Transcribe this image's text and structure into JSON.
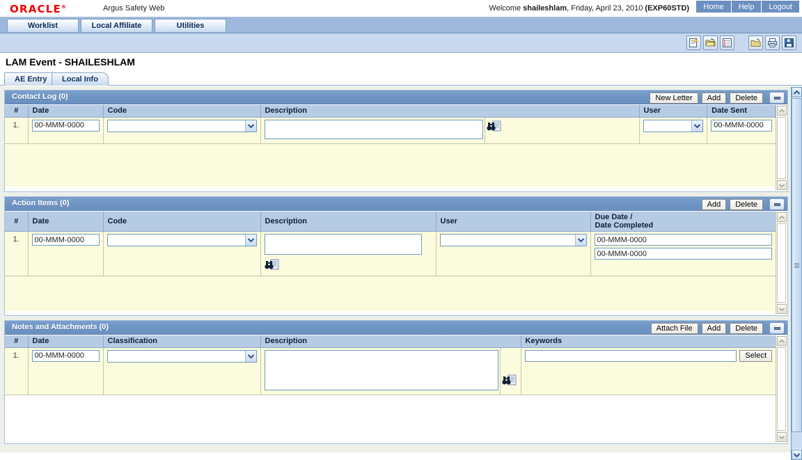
{
  "topbar": {
    "logo": "ORACLE",
    "logo_mark": "®",
    "app_title": "Argus Safety Web",
    "welcome_prefix": "Welcome ",
    "welcome_user": "shaileshlam",
    "welcome_suffix": ", Friday, April 23, 2010 ",
    "welcome_env": "(EXP60STD)",
    "nav": [
      {
        "label": "Home",
        "name": "home-link"
      },
      {
        "label": "Help",
        "name": "help-link"
      },
      {
        "label": "Logout",
        "name": "logout-link"
      }
    ]
  },
  "menubar": {
    "tabs": [
      {
        "label": "Worklist"
      },
      {
        "label": "Local Affiliate"
      },
      {
        "label": "Utilities"
      }
    ]
  },
  "toolbar": {
    "icons": [
      {
        "name": "new-case-icon",
        "title": "New"
      },
      {
        "name": "open-case-icon",
        "title": "Open"
      },
      {
        "name": "list-view-icon",
        "title": "List"
      },
      {
        "name": "revert-folder-icon",
        "title": "Revert"
      },
      {
        "name": "print-icon",
        "title": "Print"
      },
      {
        "name": "save-icon",
        "title": "Save"
      }
    ]
  },
  "page": {
    "title": "LAM Event - SHAILESHLAM",
    "tabs": [
      {
        "label": "AE Entry",
        "active": false
      },
      {
        "label": "Local Info",
        "active": true
      }
    ]
  },
  "contact_log": {
    "title": "Contact Log (0)",
    "buttons": [
      {
        "label": "New Letter",
        "name": "new-letter-button"
      },
      {
        "label": "Add",
        "name": "add-button"
      },
      {
        "label": "Delete",
        "name": "delete-button"
      }
    ],
    "minimize_title": "Minimize",
    "columns": [
      "#",
      "Date",
      "Code",
      "Description",
      "User",
      "Date Sent"
    ],
    "rows": [
      {
        "num": "1.",
        "date": "00-MMM-0000",
        "code": "",
        "description": "",
        "user": "",
        "date_sent": "00-MMM-0000"
      }
    ]
  },
  "action_items": {
    "title": "Action Items (0)",
    "buttons": [
      {
        "label": "Add",
        "name": "add-button"
      },
      {
        "label": "Delete",
        "name": "delete-button"
      }
    ],
    "minimize_title": "Minimize",
    "columns": [
      "#",
      "Date",
      "Code",
      "Description",
      "User",
      "Due Date /\nDate Completed"
    ],
    "due_header_line1": "Due Date /",
    "due_header_line2": "Date Completed",
    "rows": [
      {
        "num": "1.",
        "date": "00-MMM-0000",
        "code": "",
        "description": "",
        "user": "",
        "due_date": "00-MMM-0000",
        "date_completed": "00-MMM-0000"
      }
    ]
  },
  "notes_attachments": {
    "title": "Notes and Attachments (0)",
    "buttons": [
      {
        "label": "Attach File",
        "name": "attach-file-button"
      },
      {
        "label": "Add",
        "name": "add-button"
      },
      {
        "label": "Delete",
        "name": "delete-button"
      }
    ],
    "minimize_title": "Minimize",
    "columns": [
      "#",
      "Date",
      "Classification",
      "Description",
      "Keywords"
    ],
    "select_label": "Select",
    "rows": [
      {
        "num": "1.",
        "date": "00-MMM-0000",
        "classification": "",
        "description": "",
        "keywords": ""
      }
    ]
  },
  "colors": {
    "brand_red": "#f00000",
    "header_blue": "#6f95c4",
    "menubar_blue": "#9db8dc",
    "grid_header": "#b6cbe4",
    "row_yellow": "#fbfbdd",
    "content_bg": "#edf0e8"
  }
}
